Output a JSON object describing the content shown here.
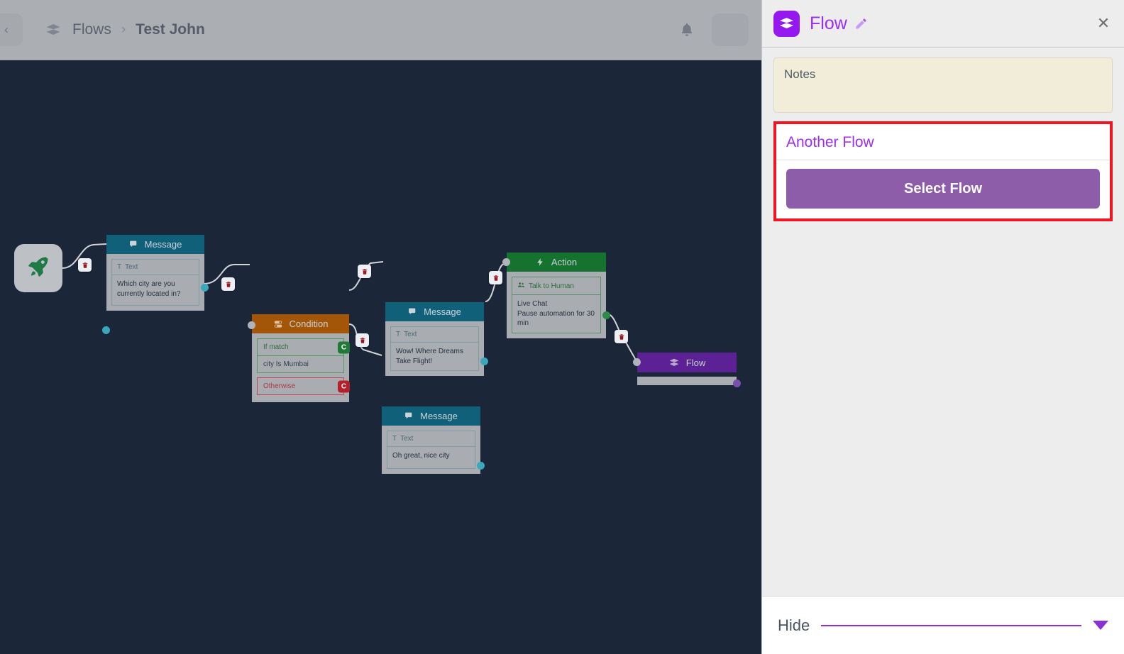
{
  "topbar": {
    "collapse_icon": "chevron-left-icon",
    "flows_icon": "flow-icon",
    "breadcrumb_root": "Flows",
    "breadcrumb_separator": "›",
    "breadcrumb_current": "Test John",
    "bell_icon": "notification-bell-icon"
  },
  "canvas": {
    "background": "#1c2639",
    "start_node": {
      "icon": "rocket-icon"
    },
    "nodes": [
      {
        "type": "message",
        "title": "Message",
        "icon": "message-icon",
        "header_color": "#11607a",
        "field_label": "Text",
        "field_icon": "text-icon",
        "text": "Which city are you currently located in?"
      },
      {
        "type": "condition",
        "title": "Condition",
        "icon": "toggle-icon",
        "header_color": "#a35607",
        "match_label": "If match",
        "condition_text": "city Is Mumbai",
        "otherwise_label": "Otherwise"
      },
      {
        "type": "message",
        "title": "Message",
        "icon": "message-icon",
        "header_color": "#11607a",
        "field_label": "Text",
        "field_icon": "text-icon",
        "text": "Wow! Where Dreams Take Flight!"
      },
      {
        "type": "message",
        "title": "Message",
        "icon": "message-icon",
        "header_color": "#11607a",
        "field_label": "Text",
        "field_icon": "text-icon",
        "text": "Oh great, nice city"
      },
      {
        "type": "action",
        "title": "Action",
        "icon": "lightning-icon",
        "header_color": "#15722f",
        "field_label": "Talk to Human",
        "field_icon": "people-icon",
        "text_line1": "Live Chat",
        "text_line2": "Pause automation for 30 min"
      },
      {
        "type": "flow",
        "title": "Flow",
        "icon": "flow-icon",
        "header_color": "#5b2195"
      }
    ],
    "edge_delete_icon": "trash-icon"
  },
  "panel": {
    "icon": "flow-icon",
    "title": "Flow",
    "edit_icon": "pencil-icon",
    "close_icon": "close-icon",
    "notes_placeholder": "Notes",
    "notes_value": "",
    "another_flow_label": "Another Flow",
    "select_flow_label": "Select Flow",
    "highlight_color": "#f31421",
    "accent_color": "#9b2df5",
    "button_color": "#8e5da9",
    "footer": {
      "hide_label": "Hide",
      "caret_icon": "chevron-down-icon"
    }
  }
}
